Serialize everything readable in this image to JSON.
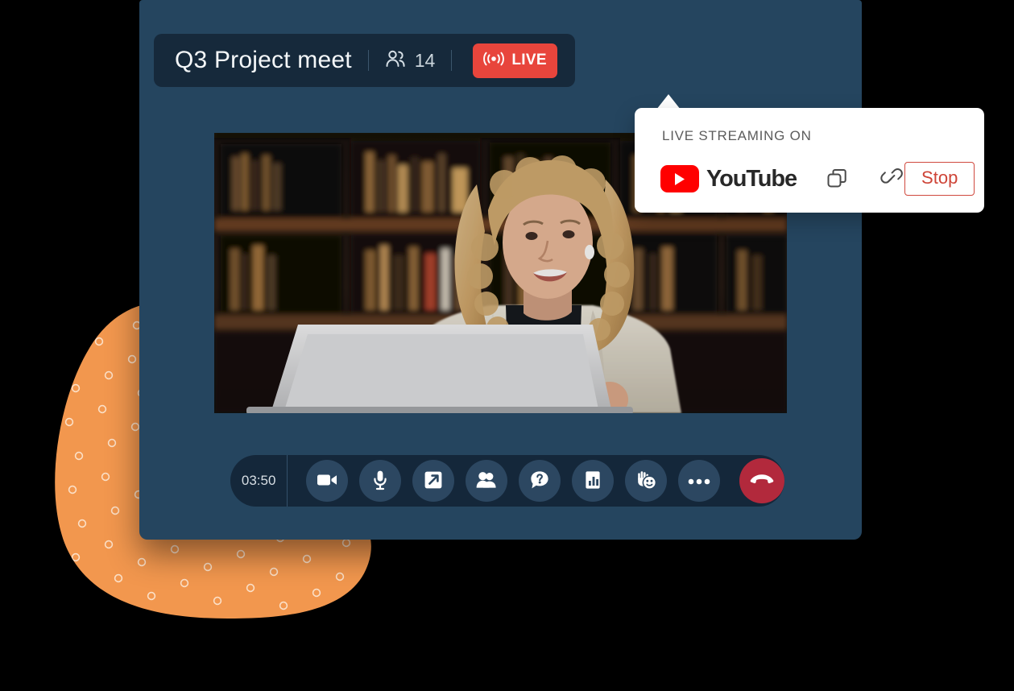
{
  "header": {
    "meeting_title": "Q3 Project meet",
    "participants_icon": "people-icon",
    "participant_count": "14",
    "live_badge": {
      "icon": "broadcast-icon",
      "label": "LIVE",
      "color": "#E8453C"
    }
  },
  "video": {
    "alt": "woman with blonde curly hair in beige blazer at laptop in library"
  },
  "popover": {
    "label": "LIVE STREAMING ON",
    "platform": "YouTube",
    "platform_color": "#FF0000",
    "copy_icon": "copy-icon",
    "link_icon": "link-icon",
    "stop_label": "Stop",
    "stop_color": "#CE4437"
  },
  "controls": {
    "timer": "03:50",
    "buttons": [
      {
        "name": "video-camera",
        "label": "Camera"
      },
      {
        "name": "microphone",
        "label": "Microphone"
      },
      {
        "name": "screen-share",
        "label": "Share screen"
      },
      {
        "name": "participants",
        "label": "Participants"
      },
      {
        "name": "qa-chat",
        "label": "Q&A"
      },
      {
        "name": "poll-chart",
        "label": "Polls"
      },
      {
        "name": "raise-hand-emoji",
        "label": "Reactions"
      },
      {
        "name": "more-options",
        "label": "More"
      },
      {
        "name": "end-call",
        "label": "Leave"
      }
    ]
  },
  "theme": {
    "window_bg": "#25455F",
    "header_bg": "#16293B",
    "bar_bg": "#14273A",
    "accent_orange": "#F2974E",
    "page_bg": "#000000"
  }
}
